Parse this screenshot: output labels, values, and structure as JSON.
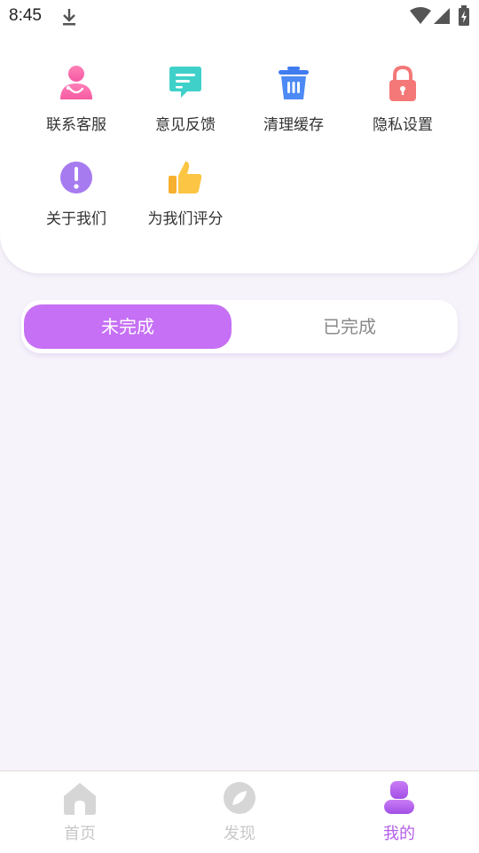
{
  "status_bar": {
    "time": "8:45"
  },
  "menu": {
    "items": [
      {
        "label": "联系客服",
        "icon": "customer-service-icon"
      },
      {
        "label": "意见反馈",
        "icon": "feedback-icon"
      },
      {
        "label": "清理缓存",
        "icon": "trash-icon"
      },
      {
        "label": "隐私设置",
        "icon": "lock-icon"
      },
      {
        "label": "关于我们",
        "icon": "info-icon"
      },
      {
        "label": "为我们评分",
        "icon": "thumbs-up-icon"
      }
    ]
  },
  "tabs": {
    "active": "未完成",
    "inactive": "已完成"
  },
  "bottom_nav": {
    "items": [
      {
        "label": "首页",
        "icon": "home-icon"
      },
      {
        "label": "发现",
        "icon": "compass-icon"
      },
      {
        "label": "我的",
        "icon": "user-icon"
      }
    ],
    "active_index": 2
  },
  "colors": {
    "accent": "#c670f5",
    "page_bg": "#f7f3fb",
    "nav_inactive": "#c8c8c8"
  }
}
